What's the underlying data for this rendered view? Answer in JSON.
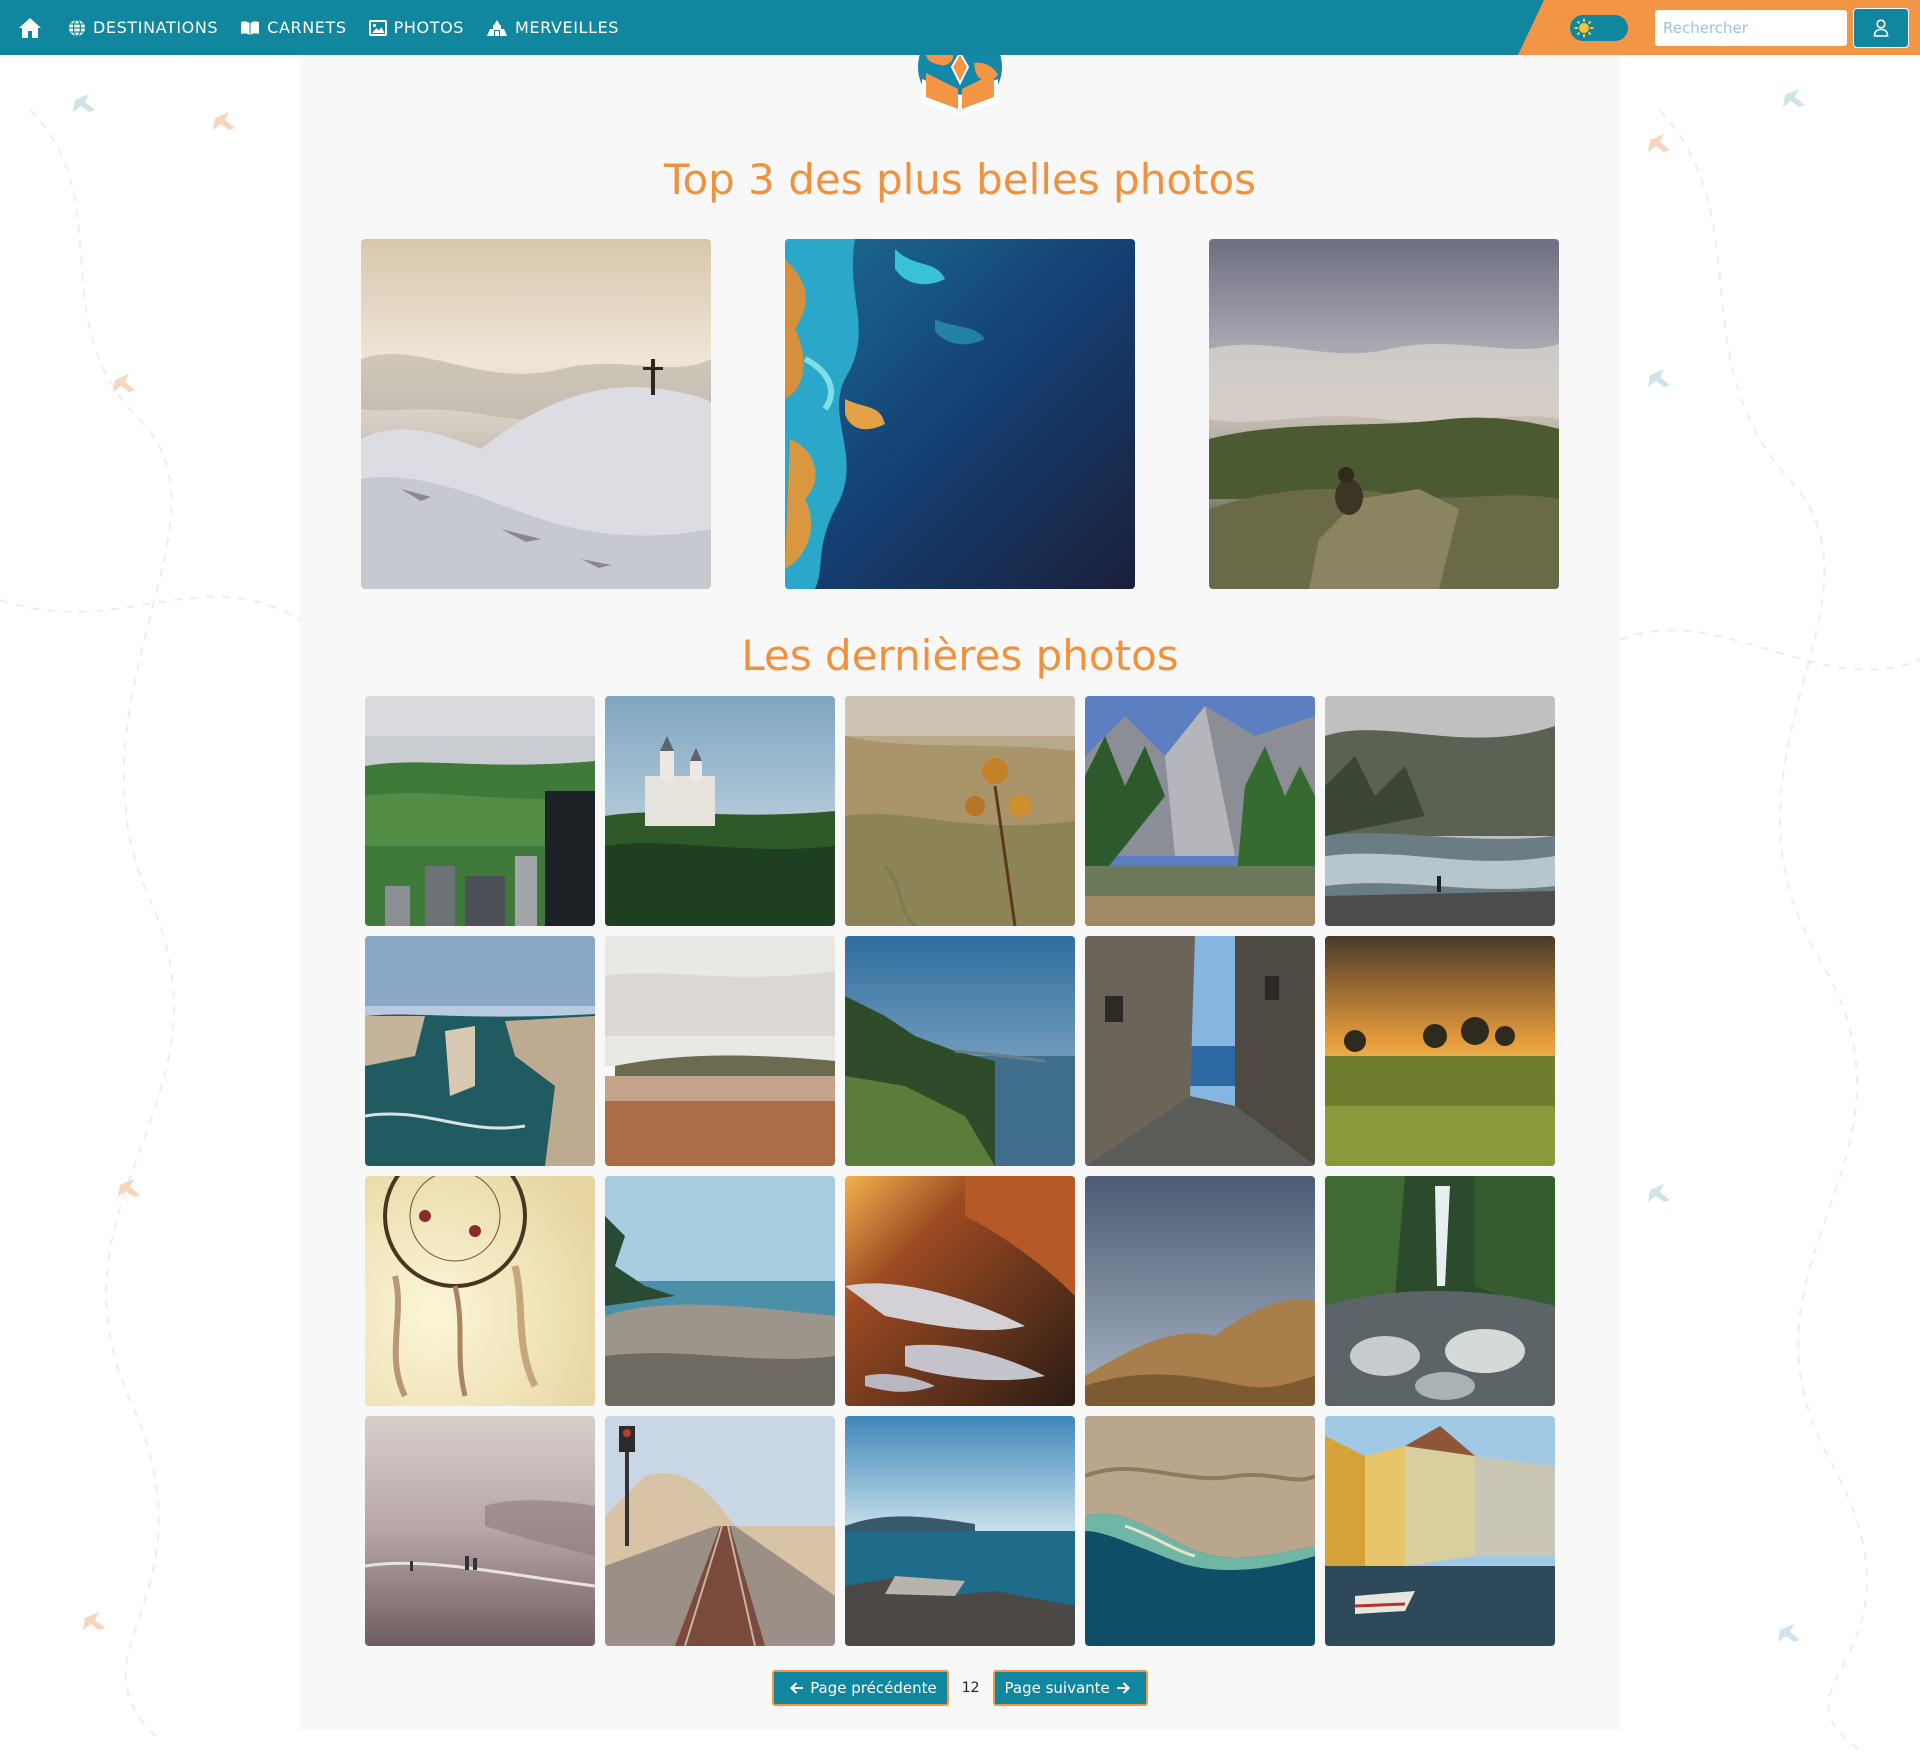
{
  "navbar": {
    "items": [
      {
        "label": "DESTINATIONS",
        "icon": "globe-icon"
      },
      {
        "label": "CARNETS",
        "icon": "book-icon"
      },
      {
        "label": "PHOTOS",
        "icon": "image-icon"
      },
      {
        "label": "MERVEILLES",
        "icon": "monument-icon"
      }
    ],
    "home_icon": "home-icon",
    "theme_icon": "sun-icon",
    "user_icon": "user-icon"
  },
  "search": {
    "placeholder": "Rechercher",
    "value": ""
  },
  "sections": {
    "top_title": "Top 3 des plus belles photos",
    "latest_title": "Les dernières photos"
  },
  "top_photos": [
    {
      "subject": "snowy-summit-cross"
    },
    {
      "subject": "aerial-ocean-reef"
    },
    {
      "subject": "hiker-above-clouds"
    }
  ],
  "latest_photos": [
    {
      "subject": "central-park-city"
    },
    {
      "subject": "castle-forest"
    },
    {
      "subject": "thistle-valley"
    },
    {
      "subject": "yosemite-cliffs"
    },
    {
      "subject": "misty-river"
    },
    {
      "subject": "sea-cliffs-coast"
    },
    {
      "subject": "beach-horizon"
    },
    {
      "subject": "coastal-mountains"
    },
    {
      "subject": "narrow-alley-sea"
    },
    {
      "subject": "sunset-meadow"
    },
    {
      "subject": "dreamcatcher"
    },
    {
      "subject": "pebble-beach"
    },
    {
      "subject": "sunset-puddles"
    },
    {
      "subject": "desert-hills"
    },
    {
      "subject": "waterfall-rocks"
    },
    {
      "subject": "misty-beach"
    },
    {
      "subject": "railway-coast"
    },
    {
      "subject": "bay-rocks"
    },
    {
      "subject": "aerial-coast"
    },
    {
      "subject": "canal-houses"
    }
  ],
  "pagination": {
    "prev_label": "Page précédente",
    "next_label": "Page suivante",
    "current_page": "12"
  },
  "colors": {
    "primary": "#10869f",
    "accent": "#f29646",
    "title": "#f0923d",
    "panel": "#f8f8f8"
  }
}
